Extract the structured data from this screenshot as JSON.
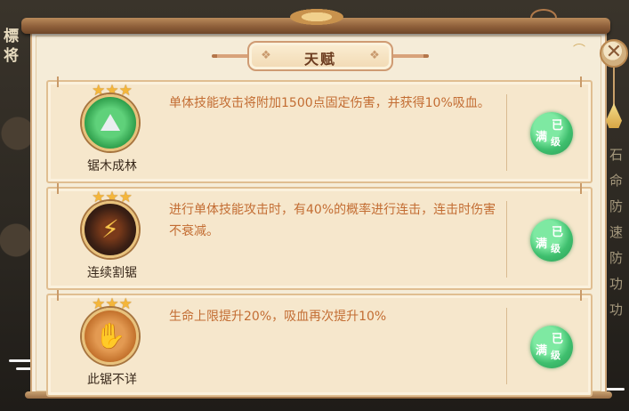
{
  "panel": {
    "title": "天赋",
    "close_label": "✕"
  },
  "background": {
    "left_text": "標将",
    "right_text": "石命防速防功功"
  },
  "talents": [
    {
      "name": "锯木成林",
      "stars": 3,
      "icon": "spikes-icon",
      "icon_color": "#3bb55b",
      "description": "单体技能攻击将附加1500点固定伤害，并获得10%吸血。",
      "status": [
        "满",
        "已",
        "级"
      ]
    },
    {
      "name": "连续割锯",
      "stars": 3,
      "icon": "lightning-icon",
      "icon_color": "#3a2418",
      "description": "进行单体技能攻击时，有40%的概率进行连击，连击时伤害不衰减。",
      "status": [
        "满",
        "已",
        "级"
      ]
    },
    {
      "name": "此锯不详",
      "stars": 3,
      "icon": "hand-icon",
      "icon_color": "#c8742e",
      "description": "生命上限提升20%，吸血再次提升10%",
      "status": [
        "满",
        "已",
        "级"
      ]
    }
  ]
}
